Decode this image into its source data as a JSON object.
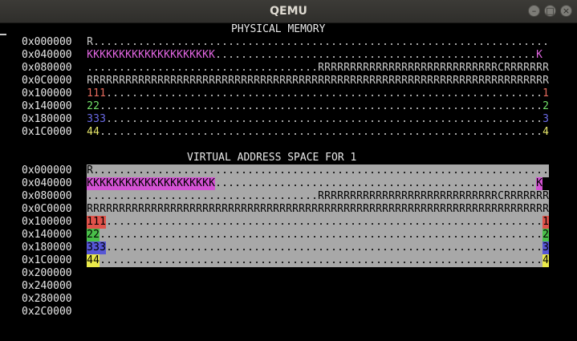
{
  "window": {
    "title": "QEMU",
    "buttons": [
      {
        "name": "minimize",
        "glyph": "–"
      },
      {
        "name": "maximize",
        "glyph": "□"
      },
      {
        "name": "close",
        "glyph": "×"
      }
    ]
  },
  "colors": {
    "K": "#e165e1",
    "proc1": "#e46a5c",
    "proc2": "#73e26a",
    "proc3": "#6a6ae6",
    "proc4": "#e8e86a",
    "plain": "#c8c8c8",
    "k_bg": "#d352d3",
    "proc1_bg": "#e0524a",
    "proc2_bg": "#49c049",
    "proc3_bg": "#5656d6",
    "proc4_bg": "#eaea4a"
  },
  "physical": {
    "title": "PHYSICAL MEMORY",
    "rows": [
      {
        "addr": "0x000000",
        "segs": [
          {
            "t": "R"
          },
          {
            "t": ".",
            "n": 71
          }
        ]
      },
      {
        "addr": "0x040000",
        "segs": [
          {
            "t": "K",
            "n": 20,
            "c": "K"
          },
          {
            "t": ".",
            "n": 50
          },
          {
            "t": "K",
            "c": "K"
          }
        ]
      },
      {
        "addr": "0x080000",
        "segs": [
          {
            "t": ".",
            "n": 36
          },
          {
            "t": "R",
            "n": 28
          },
          {
            "t": "C"
          },
          {
            "t": "R",
            "n": 7
          }
        ]
      },
      {
        "addr": "0x0C0000",
        "segs": [
          {
            "t": "R",
            "n": 72
          }
        ]
      },
      {
        "addr": "0x100000",
        "segs": [
          {
            "t": "1",
            "n": 3,
            "c": "proc1"
          },
          {
            "t": ".",
            "n": 68
          },
          {
            "t": "1",
            "c": "proc1"
          }
        ]
      },
      {
        "addr": "0x140000",
        "segs": [
          {
            "t": "2",
            "n": 2,
            "c": "proc2"
          },
          {
            "t": ".",
            "n": 69
          },
          {
            "t": "2",
            "c": "proc2"
          }
        ]
      },
      {
        "addr": "0x180000",
        "segs": [
          {
            "t": "3",
            "n": 3,
            "c": "proc3"
          },
          {
            "t": ".",
            "n": 68
          },
          {
            "t": "3",
            "c": "proc3"
          }
        ]
      },
      {
        "addr": "0x1C0000",
        "segs": [
          {
            "t": "4",
            "n": 2,
            "c": "proc4"
          },
          {
            "t": ".",
            "n": 69
          },
          {
            "t": "4",
            "c": "proc4"
          }
        ]
      }
    ]
  },
  "virtual": {
    "title": "VIRTUAL ADDRESS SPACE FOR 1",
    "rows": [
      {
        "addr": "0x000000",
        "segs": [
          {
            "t": "R"
          },
          {
            "t": ".",
            "n": 71
          }
        ]
      },
      {
        "addr": "0x040000",
        "segs": [
          {
            "t": "K",
            "n": 20,
            "c": "k_bg"
          },
          {
            "t": ".",
            "n": 50
          },
          {
            "t": "K",
            "c": "k_bg"
          }
        ]
      },
      {
        "addr": "0x080000",
        "segs": [
          {
            "t": ".",
            "n": 36
          },
          {
            "t": "R",
            "n": 28
          },
          {
            "t": "C"
          },
          {
            "t": "R",
            "n": 7
          }
        ]
      },
      {
        "addr": "0x0C0000",
        "segs": [
          {
            "t": "R",
            "n": 72
          }
        ]
      },
      {
        "addr": "0x100000",
        "segs": [
          {
            "t": "1",
            "n": 3,
            "c": "proc1_bg"
          },
          {
            "t": ".",
            "n": 68
          },
          {
            "t": "1",
            "c": "proc1_bg"
          }
        ]
      },
      {
        "addr": "0x140000",
        "segs": [
          {
            "t": "2",
            "n": 2,
            "c": "proc2_bg"
          },
          {
            "t": ".",
            "n": 69
          },
          {
            "t": "2",
            "c": "proc2_bg"
          }
        ]
      },
      {
        "addr": "0x180000",
        "segs": [
          {
            "t": "3",
            "n": 3,
            "c": "proc3_bg"
          },
          {
            "t": ".",
            "n": 68
          },
          {
            "t": "3",
            "c": "proc3_bg"
          }
        ]
      },
      {
        "addr": "0x1C0000",
        "segs": [
          {
            "t": "4",
            "n": 2,
            "c": "proc4_bg"
          },
          {
            "t": ".",
            "n": 69
          },
          {
            "t": "4",
            "c": "proc4_bg"
          }
        ]
      },
      {
        "addr": "0x200000",
        "segs": []
      },
      {
        "addr": "0x240000",
        "segs": []
      },
      {
        "addr": "0x280000",
        "segs": []
      },
      {
        "addr": "0x2C0000",
        "segs": []
      }
    ]
  }
}
